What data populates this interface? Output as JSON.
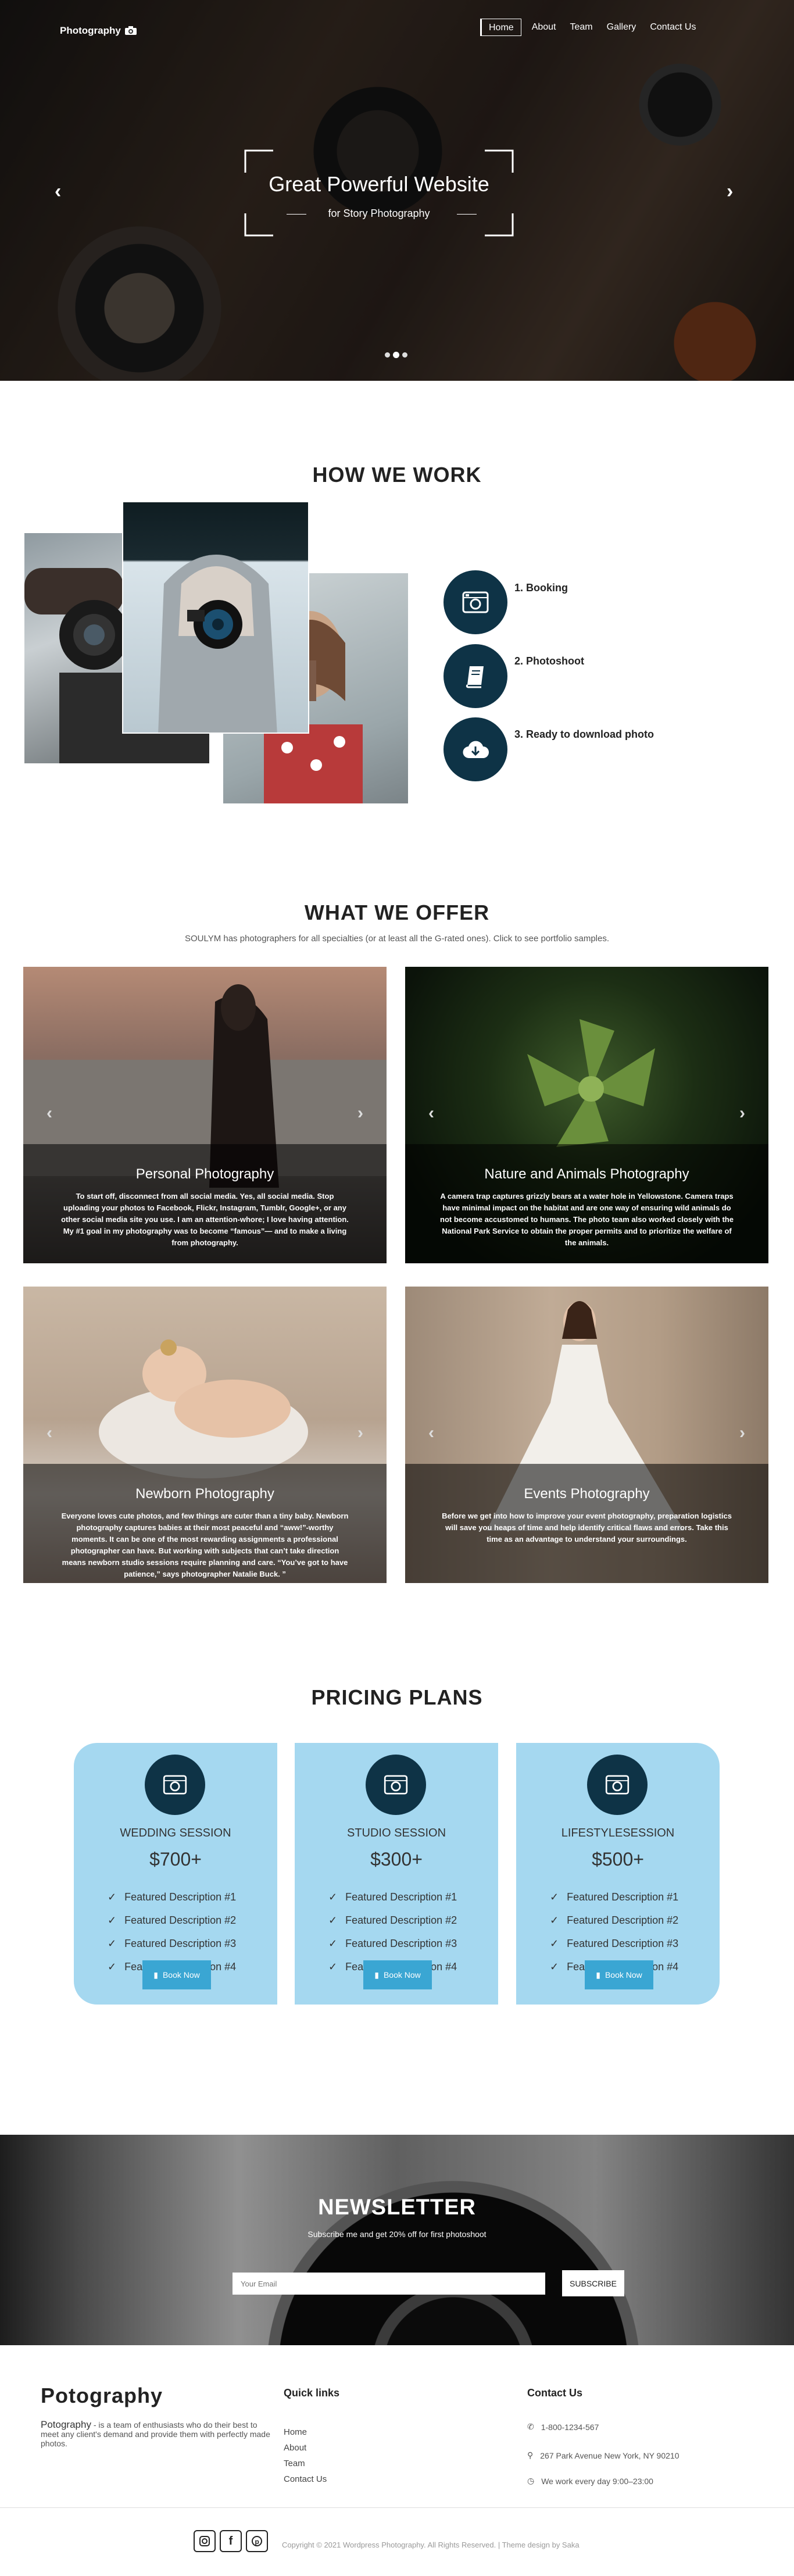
{
  "header": {
    "logo": "Photography",
    "nav": [
      "Home",
      "About",
      "Team",
      "Gallery",
      "Contact Us"
    ]
  },
  "hero": {
    "title": "Great Powerful Website",
    "subtitle": "for Story Photography",
    "slide_count": 3,
    "active_slide": 2
  },
  "how": {
    "title": "HOW WE WORK",
    "steps": [
      "1. Booking",
      "2. Photoshoot",
      "3. Ready to download photo"
    ]
  },
  "offer": {
    "title": "WHAT WE OFFER",
    "subtitle": "SOULYM has photographers for all specialties (or at least all the G-rated ones). Click to see portfolio samples.",
    "cards": [
      {
        "title": "Personal Photography",
        "text": "To start off, disconnect from all social media. Yes, all social media. Stop uploading your photos to Facebook, Flickr, Instagram, Tumblr, Google+, or any other social media site you use. I am an attention-whore; I love having attention. My #1 goal in my photography was to become “famous”— and to make a living from photography."
      },
      {
        "title": "Nature and Animals Photography",
        "text": "A camera trap captures grizzly bears at a water hole in Yellowstone. Camera traps have minimal impact on the habitat and are one way of ensuring wild animals do not become accustomed to humans. The photo team also worked closely with the National Park Service to obtain the proper permits and to prioritize the welfare of the animals."
      },
      {
        "title": "Newborn Photography",
        "text": "Everyone loves cute photos, and few things are cuter than a tiny baby. Newborn photography captures babies at their most peaceful and “aww!”-worthy moments. It can be one of the most rewarding assignments a professional photographer can have. But working with subjects that can’t take direction means newborn studio sessions require planning and care. “You’ve got to have patience,” says photographer Natalie Buck. ”"
      },
      {
        "title": "Events Photography",
        "text": "Before we get into how to improve your event photography, preparation logistics will save you heaps of time and help identify critical flaws and errors. Take this time as an advantage to understand your surroundings."
      }
    ]
  },
  "pricing": {
    "title": "PRICING PLANS",
    "plans": [
      {
        "name": "WEDDING SESSION",
        "price": "$700+",
        "features": [
          "Featured Description #1",
          "Featured Description #2",
          "Featured Description #3",
          "Featured Description #4"
        ],
        "button": "Book Now"
      },
      {
        "name": "STUDIO SESSION",
        "price": "$300+",
        "features": [
          "Featured Description #1",
          "Featured Description #2",
          "Featured Description #3",
          "Featured Description #4"
        ],
        "button": "Book Now"
      },
      {
        "name": "LIFESTYLESESSION",
        "price": "$500+",
        "features": [
          "Featured Description #1",
          "Featured Description #2",
          "Featured Description #3",
          "Featured Description #4"
        ],
        "button": "Book Now"
      }
    ]
  },
  "newsletter": {
    "title": "NEWSLETTER",
    "subtitle": "Subscribe me and get 20% off for first photoshoot",
    "placeholder": "Your Email",
    "button": "SUBSCRIBE"
  },
  "footer": {
    "brand": "Potography",
    "about_name": "Potography",
    "about_text": " - is a team of enthusiasts who do their best to meet any client's demand and provide them with perfectly made photos.",
    "links_title": "Quick links",
    "links": [
      "Home",
      "About",
      "Team",
      "Contact Us"
    ],
    "contact_title": "Contact Us",
    "phone": "1-800-1234-567",
    "address": "267 Park Avenue New York, NY 90210",
    "hours": "We work every day 9:00–23:00",
    "copyright": "Copyright © 2021 Wordpress Photography. All Rights Reserved. | Theme design by Saka"
  },
  "colors": {
    "navy": "#0e3346",
    "plan_bg": "#a5d8f0",
    "button": "#3aa6d3"
  }
}
